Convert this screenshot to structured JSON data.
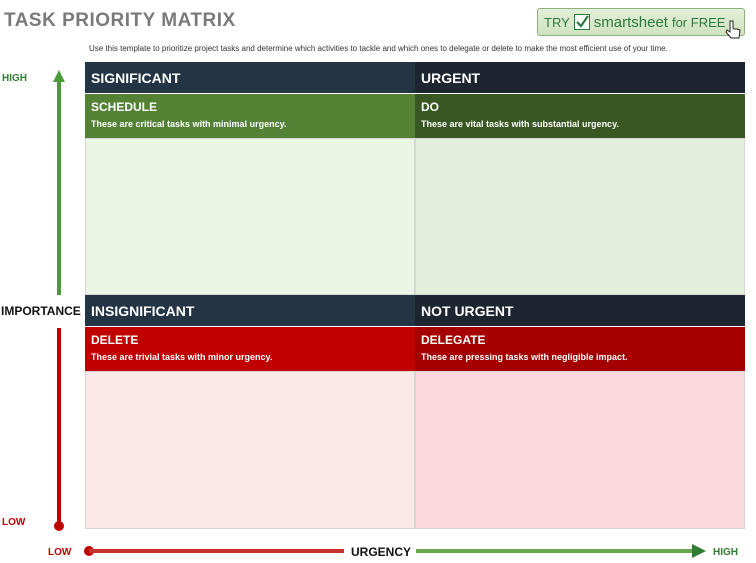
{
  "title": "TASK PRIORITY MATRIX",
  "cta": {
    "try": "TRY",
    "brand": "smartsheet",
    "suffix": "for FREE"
  },
  "description": "Use this template to prioritize project tasks and determine which activities to tackle and which ones to delegate or delete to make the most efficient use of your time.",
  "axis": {
    "importance_label": "IMPORTANCE",
    "urgency_label": "URGENCY",
    "high": "HIGH",
    "low": "LOW"
  },
  "quadrants": {
    "top_left_header": "SIGNIFICANT",
    "top_right_header": "URGENT",
    "bottom_left_header": "INSIGNIFICANT",
    "bottom_right_header": "NOT URGENT",
    "schedule": {
      "title": "SCHEDULE",
      "desc": "These are critical tasks with minimal urgency."
    },
    "do": {
      "title": "DO",
      "desc": "These are vital tasks with substantial urgency."
    },
    "delete": {
      "title": "DELETE",
      "desc": "These are trivial tasks with minor urgency."
    },
    "delegate": {
      "title": "DELEGATE",
      "desc": "These are pressing tasks with negligible impact."
    }
  },
  "colors": {
    "header_dark": "#233444",
    "header_darker": "#1c2530",
    "schedule": "#548235",
    "do": "#385723",
    "delete": "#c00000",
    "delegate": "#a50000",
    "schedule_body": "#ebf5e3",
    "do_body": "#e2efda",
    "delete_body": "#fde8e8",
    "delegate_body": "#fcd9dc"
  }
}
